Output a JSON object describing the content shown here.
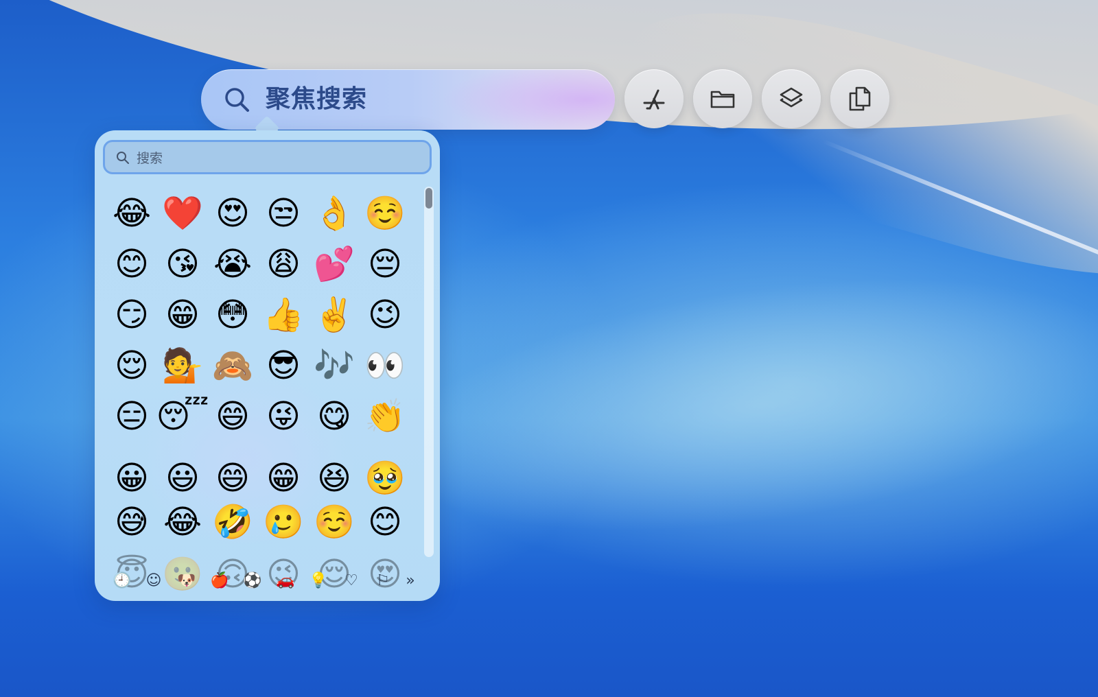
{
  "spotlight": {
    "query": "聚焦搜索",
    "icons": [
      "search-icon",
      "app-store-icon",
      "folder-icon",
      "layers-icon",
      "clipboard-icon"
    ]
  },
  "emoji_picker": {
    "search_placeholder": "搜索",
    "frequently_used": [
      "😂",
      "❤️",
      "😍",
      "😒",
      "👌",
      "☺️",
      "😊",
      "😘",
      "😭",
      "😩",
      "💕",
      "😔",
      "😏",
      "😁",
      "😳",
      "👍",
      "✌️",
      "😉",
      "😌",
      "💁",
      "🙈",
      "😎",
      "🎶",
      "👀",
      "😑",
      "😴",
      "😄",
      "😜",
      "😋",
      "👏"
    ],
    "smileys": [
      "😀",
      "😃",
      "😄",
      "😁",
      "😆",
      "🥹",
      "😅",
      "😂",
      "🤣",
      "🥲",
      "☺️",
      "😊"
    ],
    "faded_row": [
      "😇",
      "🙂",
      "🙃",
      "😉",
      "😌",
      "😍"
    ],
    "categories": [
      {
        "name": "recent",
        "glyph": "🕘"
      },
      {
        "name": "smileys",
        "glyph": "☺"
      },
      {
        "name": "animals",
        "glyph": "🐶"
      },
      {
        "name": "food",
        "glyph": "🍎"
      },
      {
        "name": "activity",
        "glyph": "⚽"
      },
      {
        "name": "travel",
        "glyph": "🚗"
      },
      {
        "name": "objects",
        "glyph": "💡"
      },
      {
        "name": "symbols",
        "glyph": "♡"
      },
      {
        "name": "flags",
        "glyph": "⚐"
      },
      {
        "name": "more",
        "glyph": "»"
      }
    ]
  }
}
